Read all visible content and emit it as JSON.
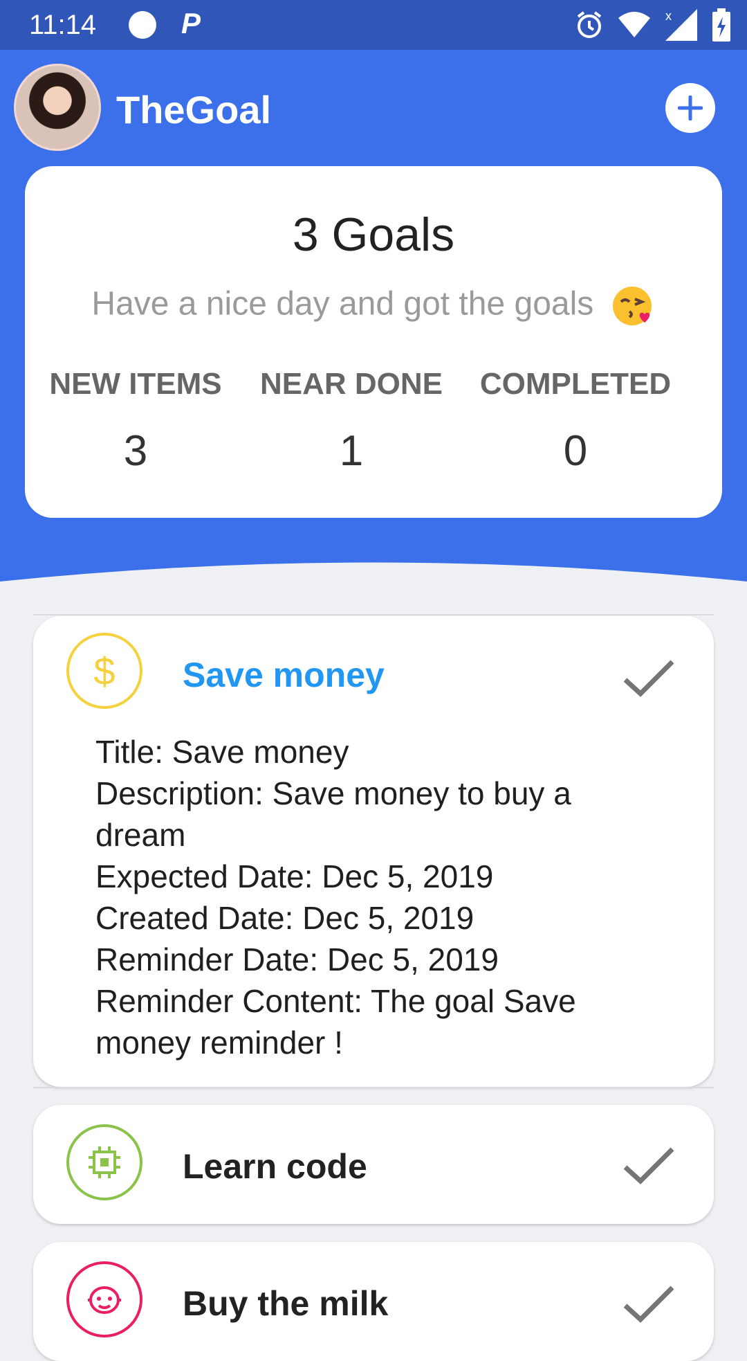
{
  "status_bar": {
    "time": "11:14",
    "left_icons": [
      "circle-notification-icon",
      "parking-icon"
    ],
    "right_icons": [
      "alarm-icon",
      "wifi-icon",
      "signal-icon",
      "battery-charging-icon"
    ]
  },
  "header": {
    "app_title": "TheGoal",
    "add_icon": "plus-icon"
  },
  "summary": {
    "goals_count": "3 Goals",
    "greeting": "Have a nice day and got the goals",
    "emoji": "kissing-face-emoji",
    "stats": [
      {
        "label": "NEW ITEMS",
        "value": "3"
      },
      {
        "label": "NEAR DONE",
        "value": "1"
      },
      {
        "label": "COMPLETED",
        "value": "0"
      }
    ]
  },
  "goals": [
    {
      "title": "Save money",
      "icon": "dollar-icon",
      "icon_color": "#f5d13d",
      "title_color": "#2196f3",
      "expanded": true,
      "details": {
        "title": "Title: Save money",
        "description": "Description: Save money to buy a dream",
        "expected_date": "Expected Date: Dec 5, 2019",
        "created_date": "Created Date: Dec 5, 2019",
        "reminder_date": "Reminder Date: Dec 5, 2019",
        "reminder_content": "Reminder Content: The goal Save money reminder !"
      }
    },
    {
      "title": "Learn code",
      "icon": "chip-icon",
      "icon_color": "#8bc34a",
      "title_color": "#222222",
      "expanded": false
    },
    {
      "title": "Buy the milk",
      "icon": "baby-face-icon",
      "icon_color": "#e91e63",
      "title_color": "#222222",
      "expanded": false
    }
  ],
  "colors": {
    "status_bar": "#2f56b8",
    "header": "#3b70ea",
    "background": "#eef0f3",
    "check": "#757575"
  }
}
